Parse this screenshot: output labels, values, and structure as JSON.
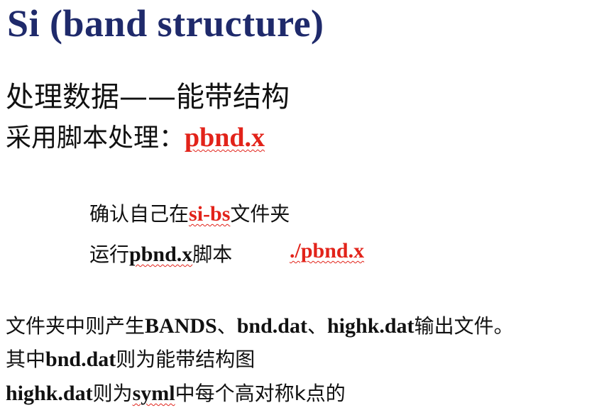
{
  "slide": {
    "title": "Si (band structure)",
    "subtitle": "处理数据——能带结构",
    "script_prefix": "采用脚本处理：",
    "script_name": "pbnd.x",
    "step1": {
      "pre": "确认自己在",
      "folder": "si-bs",
      "post": "文件夹"
    },
    "step2": {
      "pre": "运行",
      "script": "pbnd.x",
      "post": "脚本",
      "command": "./pbnd.x"
    },
    "body1": {
      "pre": "文件夹中则产生",
      "files": "BANDS",
      "sep1": "、",
      "file2": "bnd.dat",
      "sep2": "、",
      "file3": "highk.dat",
      "post": "输出文件。"
    },
    "body2": {
      "pre": "其中",
      "file": "bnd.dat",
      "post": "则为能带结构图"
    },
    "body3": {
      "file": "highk.dat",
      "mid": "则为",
      "syml": "syml",
      "post": "中每个高对称k点的"
    }
  }
}
